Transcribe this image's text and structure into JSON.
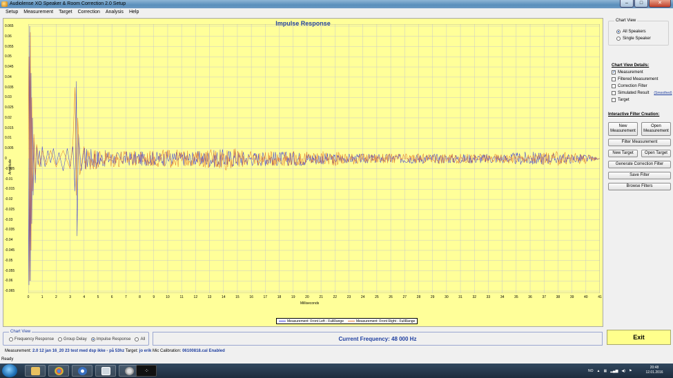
{
  "window": {
    "title": "Audiolense XO Speaker & Room Correction 2.0 Setup"
  },
  "menu": [
    "Setup",
    "Measurement",
    "Target",
    "Correction",
    "Analysis",
    "Help"
  ],
  "chart_data": {
    "type": "line",
    "title": "Impulse Response",
    "xlabel": "Milliseconds",
    "ylabel": "Amplitude",
    "xlim": [
      0,
      41
    ],
    "ylim": [
      -0.066,
      0.066
    ],
    "x_ticks": [
      "0",
      "1",
      "2",
      "3",
      "4",
      "5",
      "6",
      "7",
      "8",
      "9",
      "10",
      "11",
      "12",
      "13",
      "14",
      "15",
      "16",
      "17",
      "18",
      "19",
      "20",
      "21",
      "22",
      "23",
      "24",
      "25",
      "26",
      "27",
      "28",
      "29",
      "30",
      "31",
      "32",
      "33",
      "34",
      "35",
      "36",
      "37",
      "38",
      "39",
      "40",
      "41"
    ],
    "y_ticks": [
      "0.065",
      "0.06",
      "0.055",
      "0.05",
      "0.045",
      "0.04",
      "0.035",
      "0.03",
      "0.025",
      "0.02",
      "0.015",
      "0.01",
      "0.005",
      "0",
      "-0.005",
      "-0.01",
      "-0.015",
      "-0.02",
      "-0.025",
      "-0.03",
      "-0.035",
      "-0.04",
      "-0.045",
      "-0.05",
      "-0.055",
      "-0.06",
      "-0.065"
    ],
    "grid": true,
    "legend_position": "bottom-center",
    "series": [
      {
        "name": "Measurement: Front Left - FullRange",
        "color": "#3a3ad6",
        "points": [
          [
            0,
            0
          ],
          [
            0.05,
            -0.062
          ],
          [
            0.1,
            0.065
          ],
          [
            0.15,
            -0.06
          ],
          [
            0.2,
            0.042
          ],
          [
            0.25,
            -0.032
          ],
          [
            0.3,
            0.02
          ],
          [
            0.35,
            -0.018
          ],
          [
            0.4,
            0.01
          ],
          [
            0.5,
            -0.012
          ],
          [
            0.6,
            0.006
          ],
          [
            0.7,
            -0.003
          ],
          [
            0.8,
            0.004
          ],
          [
            0.9,
            -0.004
          ],
          [
            1.0,
            0.006
          ],
          [
            1.2,
            -0.004
          ],
          [
            1.4,
            0.004
          ],
          [
            1.6,
            -0.002
          ],
          [
            1.8,
            0.005
          ],
          [
            2.0,
            -0.003
          ],
          [
            2.2,
            0.003
          ],
          [
            2.5,
            -0.006
          ],
          [
            2.8,
            0.005
          ],
          [
            3.0,
            -0.004
          ],
          [
            3.2,
            0.006
          ],
          [
            3.35,
            -0.016
          ],
          [
            3.45,
            0.038
          ],
          [
            3.5,
            -0.038
          ],
          [
            3.6,
            0.012
          ],
          [
            3.8,
            -0.006
          ],
          [
            4.0,
            0.005
          ],
          [
            5.0,
            -0.004
          ],
          [
            6.0,
            0.003
          ],
          [
            8.0,
            -0.003
          ],
          [
            10.0,
            0.003
          ],
          [
            12.0,
            -0.003
          ],
          [
            14.0,
            0.004
          ],
          [
            16.0,
            -0.003
          ],
          [
            18.0,
            0.003
          ],
          [
            20.0,
            -0.003
          ],
          [
            22.0,
            0.002
          ],
          [
            24.0,
            -0.002
          ],
          [
            26.0,
            0.002
          ],
          [
            28.0,
            -0.002
          ],
          [
            30.0,
            0.002
          ],
          [
            32.0,
            -0.002
          ],
          [
            34.0,
            0.002
          ],
          [
            36.0,
            0.003
          ],
          [
            38.0,
            -0.002
          ],
          [
            40.0,
            0.002
          ],
          [
            41.0,
            0
          ]
        ]
      },
      {
        "name": "Measurement: Front Right - FullRange",
        "color": "#e0742a",
        "points": [
          [
            0,
            0
          ],
          [
            0.05,
            0.05
          ],
          [
            0.1,
            -0.06
          ],
          [
            0.15,
            0.062
          ],
          [
            0.2,
            -0.045
          ],
          [
            0.25,
            0.03
          ],
          [
            0.3,
            -0.016
          ],
          [
            0.4,
            0.012
          ],
          [
            0.5,
            -0.008
          ],
          [
            0.6,
            0.007
          ],
          [
            0.8,
            -0.004
          ],
          [
            1.0,
            0.004
          ],
          [
            1.3,
            -0.003
          ],
          [
            1.6,
            0.004
          ],
          [
            2.0,
            -0.004
          ],
          [
            2.5,
            0.004
          ],
          [
            3.0,
            -0.005
          ],
          [
            3.2,
            0.008
          ],
          [
            3.35,
            0.035
          ],
          [
            3.45,
            -0.018
          ],
          [
            3.55,
            0.02
          ],
          [
            3.7,
            -0.008
          ],
          [
            4.0,
            0.006
          ],
          [
            5.0,
            -0.004
          ],
          [
            6.0,
            0.004
          ],
          [
            8.0,
            -0.003
          ],
          [
            10.0,
            0.004
          ],
          [
            12.0,
            -0.003
          ],
          [
            14.0,
            0.005
          ],
          [
            16.0,
            -0.003
          ],
          [
            18.0,
            0.003
          ],
          [
            20.0,
            -0.003
          ],
          [
            22.0,
            0.003
          ],
          [
            24.0,
            -0.002
          ],
          [
            26.0,
            0.002
          ],
          [
            28.0,
            -0.002
          ],
          [
            30.0,
            0.002
          ],
          [
            32.0,
            -0.002
          ],
          [
            34.0,
            0.002
          ],
          [
            36.0,
            -0.002
          ],
          [
            38.0,
            0.003
          ],
          [
            40.0,
            -0.002
          ],
          [
            41.0,
            0
          ]
        ]
      }
    ]
  },
  "right_panel": {
    "chart_view_group": {
      "title": "Chart View",
      "options": [
        "All Speakers",
        "Single Speaker"
      ],
      "selected": "All Speakers"
    },
    "details_title": "Chart View Details:",
    "details": [
      {
        "label": "Measurement",
        "checked": true
      },
      {
        "label": "Filtered Measurement",
        "checked": false
      },
      {
        "label": "Correction Filter",
        "checked": false
      },
      {
        "label": "Simulated Result",
        "checked": false,
        "link": "(Smoothed)"
      },
      {
        "label": "Target",
        "checked": false
      }
    ],
    "interactive_title": "Interactive Filter Creation:",
    "buttons": {
      "new_measurement": "New Measurement",
      "open_measurement": "Open Measurement",
      "filter_measurement": "Filter Measurement",
      "new_target": "New Target",
      "open_target": "Open Target",
      "generate_correction_filter": "Generate Correction Filter",
      "save_filter": "Save Filter",
      "browse_filters": "Browse Filters"
    }
  },
  "bottom": {
    "chart_view_title": "Chart View",
    "chart_view_options": [
      "Frequency Response",
      "Group Delay",
      "Impulse Response",
      "All"
    ],
    "chart_view_selected": "Impulse Response",
    "current_frequency": "Current Frequency: 48 000 Hz",
    "exit_label": "Exit"
  },
  "info": {
    "measurement_label": "Measurement:",
    "measurement_value": "2.0 12 jan 16_20 23 test med dsp ikke - på 53hz",
    "target_label": "Target:",
    "target_value": "jo erik",
    "mic_label": "Mic Calibration:",
    "mic_value": "06100818.cal Enabled",
    "status": "Ready"
  },
  "taskbar": {
    "lang": "NO",
    "time": "20:48",
    "date": "12.01.2016"
  },
  "colors": {
    "chart_bg": "#ffff99",
    "accent": "#1f3fa0",
    "exit_bg": "#ffff8c"
  }
}
